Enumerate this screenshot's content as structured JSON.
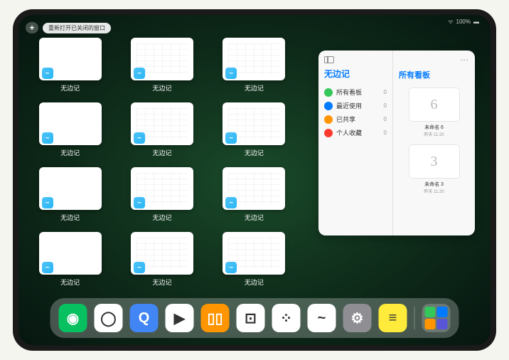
{
  "status": {
    "signal": "⋯",
    "battery": "100%"
  },
  "topbar": {
    "plus": "+",
    "reopen_label": "重新打开已关闭的窗口"
  },
  "app_name": "无边记",
  "windows": [
    {
      "label": "无边记",
      "has_content": false
    },
    {
      "label": "无边记",
      "has_content": true
    },
    {
      "label": "无边记",
      "has_content": true
    },
    {
      "label": "无边记",
      "has_content": false
    },
    {
      "label": "无边记",
      "has_content": true
    },
    {
      "label": "无边记",
      "has_content": true
    },
    {
      "label": "无边记",
      "has_content": false
    },
    {
      "label": "无边记",
      "has_content": true
    },
    {
      "label": "无边记",
      "has_content": true
    },
    {
      "label": "无边记",
      "has_content": false
    },
    {
      "label": "无边记",
      "has_content": true
    },
    {
      "label": "无边记",
      "has_content": true
    }
  ],
  "panel": {
    "title": "无边记",
    "items": [
      {
        "label": "所有看板",
        "count": "0",
        "color": "#34c759"
      },
      {
        "label": "最近使用",
        "count": "0",
        "color": "#007aff"
      },
      {
        "label": "已共享",
        "count": "0",
        "color": "#ff9500"
      },
      {
        "label": "个人收藏",
        "count": "0",
        "color": "#ff3b30"
      }
    ],
    "right_title": "所有看板",
    "boards": [
      {
        "glyph": "6",
        "label": "未命名 6",
        "sub": "昨天 11:20"
      },
      {
        "glyph": "3",
        "label": "未命名 3",
        "sub": "昨天 11:20"
      }
    ]
  },
  "dock": {
    "apps": [
      {
        "name": "wechat",
        "bg": "#07c160",
        "glyph": "◉"
      },
      {
        "name": "quark-hd",
        "bg": "#fff",
        "glyph": "◯"
      },
      {
        "name": "quark",
        "bg": "#4285f4",
        "glyph": "Q"
      },
      {
        "name": "play",
        "bg": "#fff",
        "glyph": "▶"
      },
      {
        "name": "books",
        "bg": "#ff9500",
        "glyph": "▯▯"
      },
      {
        "name": "dice",
        "bg": "#fff",
        "glyph": "⊡"
      },
      {
        "name": "dots",
        "bg": "#fff",
        "glyph": "⁘"
      },
      {
        "name": "freeform",
        "bg": "#fff",
        "glyph": "~"
      },
      {
        "name": "settings",
        "bg": "#8e8e93",
        "glyph": "⚙"
      },
      {
        "name": "notes",
        "bg": "#ffeb3b",
        "glyph": "≡"
      }
    ]
  }
}
